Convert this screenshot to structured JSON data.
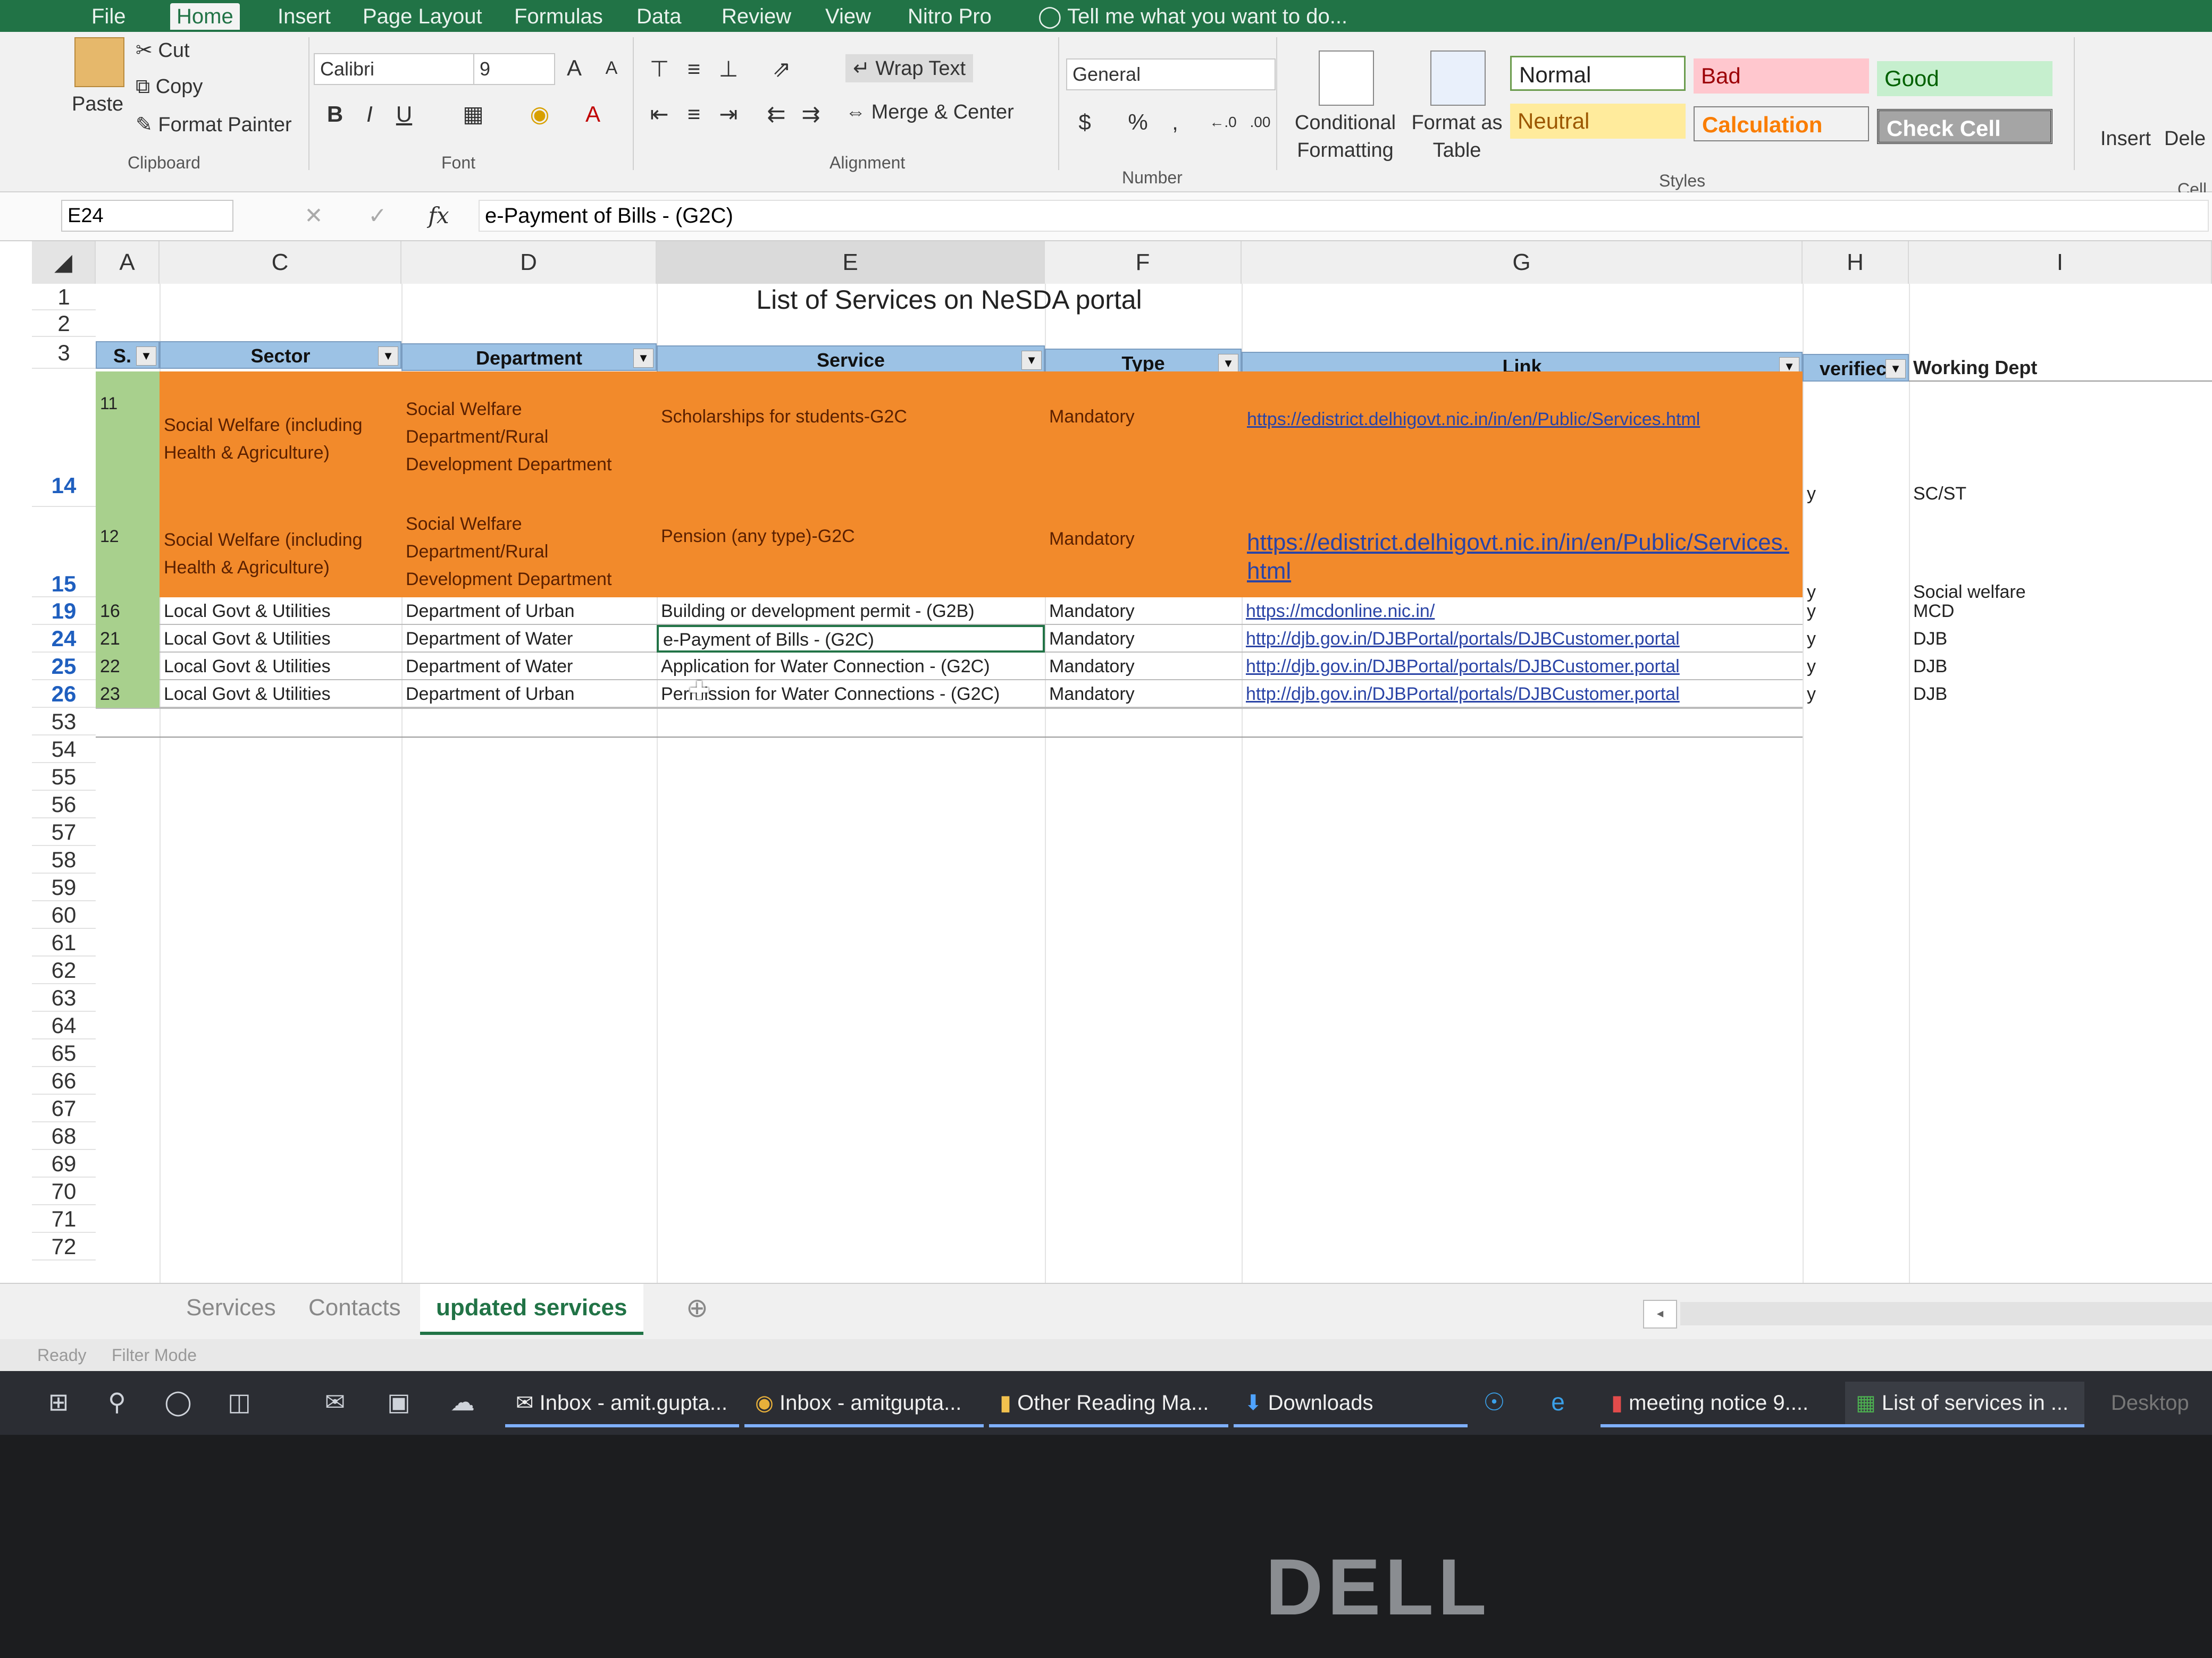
{
  "menu": [
    "File",
    "Home",
    "Insert",
    "Page Layout",
    "Formulas",
    "Data",
    "Review",
    "View",
    "Nitro Pro"
  ],
  "tell_me": "Tell me what you want to do...",
  "ribbon": {
    "clipboard": {
      "paste": "Paste",
      "cut": "Cut",
      "copy": "Copy",
      "format_painter": "Format Painter",
      "label": "Clipboard"
    },
    "font": {
      "name": "Calibri",
      "size": "9",
      "bold": "B",
      "italic": "I",
      "underline": "U",
      "label": "Font"
    },
    "alignment": {
      "wrap": "Wrap Text",
      "merge": "Merge & Center",
      "label": "Alignment"
    },
    "number": {
      "format": "General",
      "currency": "$",
      "percent": "%",
      "comma": ",",
      "label": "Number"
    },
    "conditional": "Conditional Formatting",
    "format_table": "Format as Table",
    "styles": {
      "normal": "Normal",
      "bad": "Bad",
      "good": "Good",
      "neutral": "Neutral",
      "calculation": "Calculation",
      "check_cell": "Check Cell",
      "label": "Styles"
    },
    "insert": "Insert",
    "delete": "Dele",
    "cells_label": "Cell"
  },
  "formula_bar": {
    "name_box": "E24",
    "fx": "fx",
    "value": "e-Payment of Bills - (G2C)"
  },
  "columns": [
    "A",
    "C",
    "D",
    "E",
    "F",
    "G",
    "H",
    "I"
  ],
  "sheet_title": "List of Services on NeSDA portal",
  "headers": {
    "sno": "S. I",
    "sector": "Sector",
    "department": "Department",
    "service": "Service",
    "type": "Type",
    "link": "Link",
    "verified": "verifiec",
    "working": "Working Dept"
  },
  "rows": [
    {
      "row": "14",
      "sno": "11",
      "sector": "Social Welfare (including Health & Agriculture)",
      "department": "Social Welfare Department/Rural Development Department",
      "service": "Scholarships for students-G2C",
      "type": "Mandatory",
      "link": "https://edistrict.delhigovt.nic.in/in/en/Public/Services.html",
      "verified": "y",
      "working": "SC/ST"
    },
    {
      "row": "15",
      "sno": "12",
      "sector": "Social Welfare (including Health & Agriculture)",
      "department": "Social Welfare Department/Rural Development Department",
      "service": "Pension (any type)-G2C",
      "type": "Mandatory",
      "link": "https://edistrict.delhigovt.nic.in/in/en/Public/Services.html",
      "verified": "y",
      "working": "Social welfare"
    },
    {
      "row": "19",
      "sno": "16",
      "sector": "Local Govt & Utilities",
      "department": "Department of Urban",
      "service": "Building or development permit - (G2B)",
      "type": "Mandatory",
      "link": "https://mcdonline.nic.in/",
      "verified": "y",
      "working": "MCD"
    },
    {
      "row": "24",
      "sno": "21",
      "sector": "Local Govt & Utilities",
      "department": "Department of Water",
      "service": "e-Payment of Bills - (G2C)",
      "type": "Mandatory",
      "link": "http://djb.gov.in/DJBPortal/portals/DJBCustomer.portal",
      "verified": "y",
      "working": "DJB"
    },
    {
      "row": "25",
      "sno": "22",
      "sector": "Local Govt & Utilities",
      "department": "Department of Water",
      "service": "Application for Water Connection - (G2C)",
      "type": "Mandatory",
      "link": "http://djb.gov.in/DJBPortal/portals/DJBCustomer.portal",
      "verified": "y",
      "working": "DJB"
    },
    {
      "row": "26",
      "sno": "23",
      "sector": "Local Govt & Utilities",
      "department": "Department of Urban",
      "service": "Permission for Water Connections - (G2C)",
      "type": "Mandatory",
      "link": "http://djb.gov.in/DJBPortal/portals/DJBCustomer.portal",
      "verified": "y",
      "working": "DJB"
    }
  ],
  "empty_rows": [
    "53",
    "54",
    "55",
    "56",
    "57",
    "58",
    "59",
    "60",
    "61",
    "62",
    "63",
    "64",
    "65",
    "66",
    "67",
    "68",
    "69",
    "70",
    "71",
    "72"
  ],
  "sheet_tabs": [
    "Services",
    "Contacts",
    "updated services"
  ],
  "status": {
    "ready": "Ready",
    "mode": "Filter Mode"
  },
  "taskbar": [
    "Inbox - amit.gupta...",
    "Inbox - amitgupta...",
    "Other Reading Ma...",
    "Downloads",
    "meeting notice 9....",
    "List of services in ...",
    "Desktop"
  ],
  "bezel_logo": "DELL"
}
